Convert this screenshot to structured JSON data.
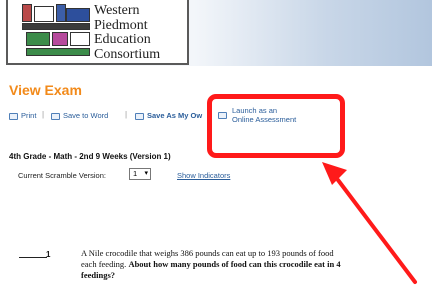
{
  "header": {
    "logo_lines": [
      "Western",
      "Piedmont",
      "Education",
      "Consortium"
    ],
    "colors": {
      "accent": "#f28a1a",
      "link": "#2a5d9a",
      "highlight": "#ff1a1a"
    }
  },
  "page": {
    "title": "View Exam"
  },
  "toolbar": {
    "print": "Print",
    "save_word": "Save to Word",
    "save_as": "Save As My Ow",
    "launch_line1": "Launch as an",
    "launch_line2": "Online Assessment"
  },
  "exam": {
    "title": "4th Grade - Math - 2nd 9 Weeks   (Version 1)",
    "scramble_label": "Current Scramble Version:",
    "scramble_value": "1",
    "show_indicators": "Show Indicators"
  },
  "question": {
    "number": "1",
    "text_part1": "A Nile crocodile that weighs 386 pounds can eat up to 193 pounds of food",
    "text_part2": "each feeding. ",
    "text_bold1": "About how many pounds of food can this crocodile eat in 4",
    "text_bold2": "feedings?"
  }
}
